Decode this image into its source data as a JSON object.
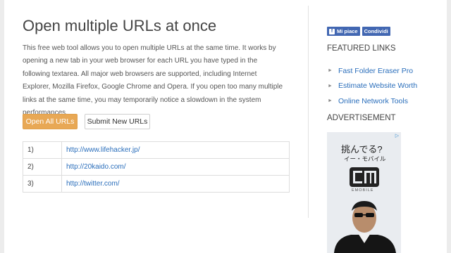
{
  "main": {
    "title": "Open multiple URLs at once",
    "description": "This free web tool allows you to open multiple URLs at the same time. It works by opening a new tab in your web browser for each URL you have typed in the following textarea. All major web browsers are supported, including Internet Explorer, Mozilla Firefox, Google Chrome and Opera. If you open too many multiple links at the same time, you may temporarily notice a slowdown in the system performances.",
    "open_all_label": "Open All URLs",
    "submit_new_label": "Submit New URLs",
    "urls": [
      {
        "num": "1)",
        "url": "http://www.lifehacker.jp/"
      },
      {
        "num": "2)",
        "url": "http://20kaido.com/"
      },
      {
        "num": "3)",
        "url": "http://twitter.com/"
      }
    ]
  },
  "sidebar": {
    "like_label": "Mi piace",
    "share_label": "Condividi",
    "featured_heading": "FEATURED LINKS",
    "featured_links": [
      "Fast Folder Eraser Pro",
      "Estimate Website Worth",
      "Online Network Tools"
    ],
    "ad_heading": "ADVERTISEMENT",
    "ad": {
      "line1": "挑んでる?",
      "line2": "イー・モバイル",
      "brand": "EMOBILE",
      "choices_icon": "ad-choices-icon"
    }
  },
  "colors": {
    "accent_button": "#e8a855",
    "link": "#2a6ebb",
    "facebook": "#4267b2"
  }
}
